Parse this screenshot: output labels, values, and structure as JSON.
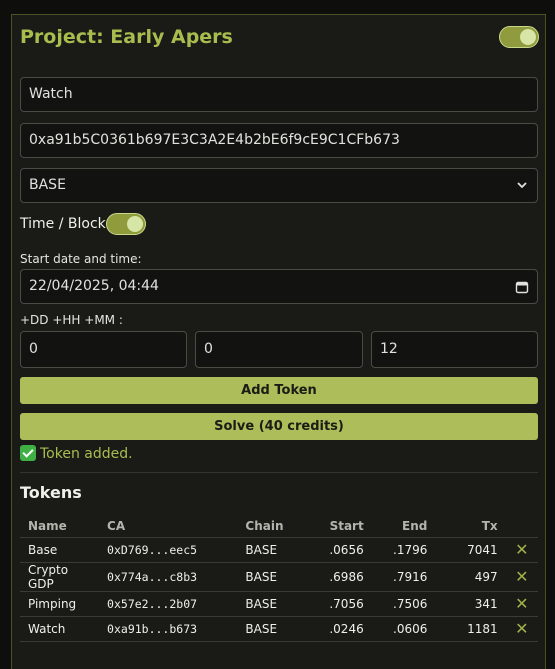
{
  "header": {
    "title": "Project: Early Apers",
    "enabled": true
  },
  "form": {
    "name_value": "Watch",
    "address_value": "0xa91b5C0361b697E3C3A2E4b2bE6f9cE9C1CFb673",
    "chain_value": "BASE",
    "mode_label": "Time / Block",
    "start_label": "Start date and time:",
    "start_value": "22/04/2025, 04:44",
    "offset_label": "+DD +HH +MM :",
    "dd_value": "0",
    "hh_value": "0",
    "mm_value": "12"
  },
  "actions": {
    "add_label": "Add Token",
    "solve_label": "Solve (40 credits)"
  },
  "status": {
    "message": "Token added."
  },
  "tokens": {
    "title": "Tokens",
    "headers": [
      "Name",
      "CA",
      "Chain",
      "Start",
      "End",
      "Tx"
    ],
    "rows": [
      {
        "name": "Base",
        "ca": "0xD769...eec5",
        "chain": "BASE",
        "start": ".0656",
        "end": ".1796",
        "tx": "7041"
      },
      {
        "name": "Crypto GDP",
        "ca": "0x774a...c8b3",
        "chain": "BASE",
        "start": ".6986",
        "end": ".7916",
        "tx": "497"
      },
      {
        "name": "Pimping",
        "ca": "0x57e2...2b07",
        "chain": "BASE",
        "start": ".7056",
        "end": ".7506",
        "tx": "341"
      },
      {
        "name": "Watch",
        "ca": "0xa91b...b673",
        "chain": "BASE",
        "start": ".0246",
        "end": ".0606",
        "tx": "1181"
      }
    ]
  },
  "colors": {
    "accent": "#a9bd4f",
    "button": "#adbd59",
    "background": "#1a1b17"
  }
}
